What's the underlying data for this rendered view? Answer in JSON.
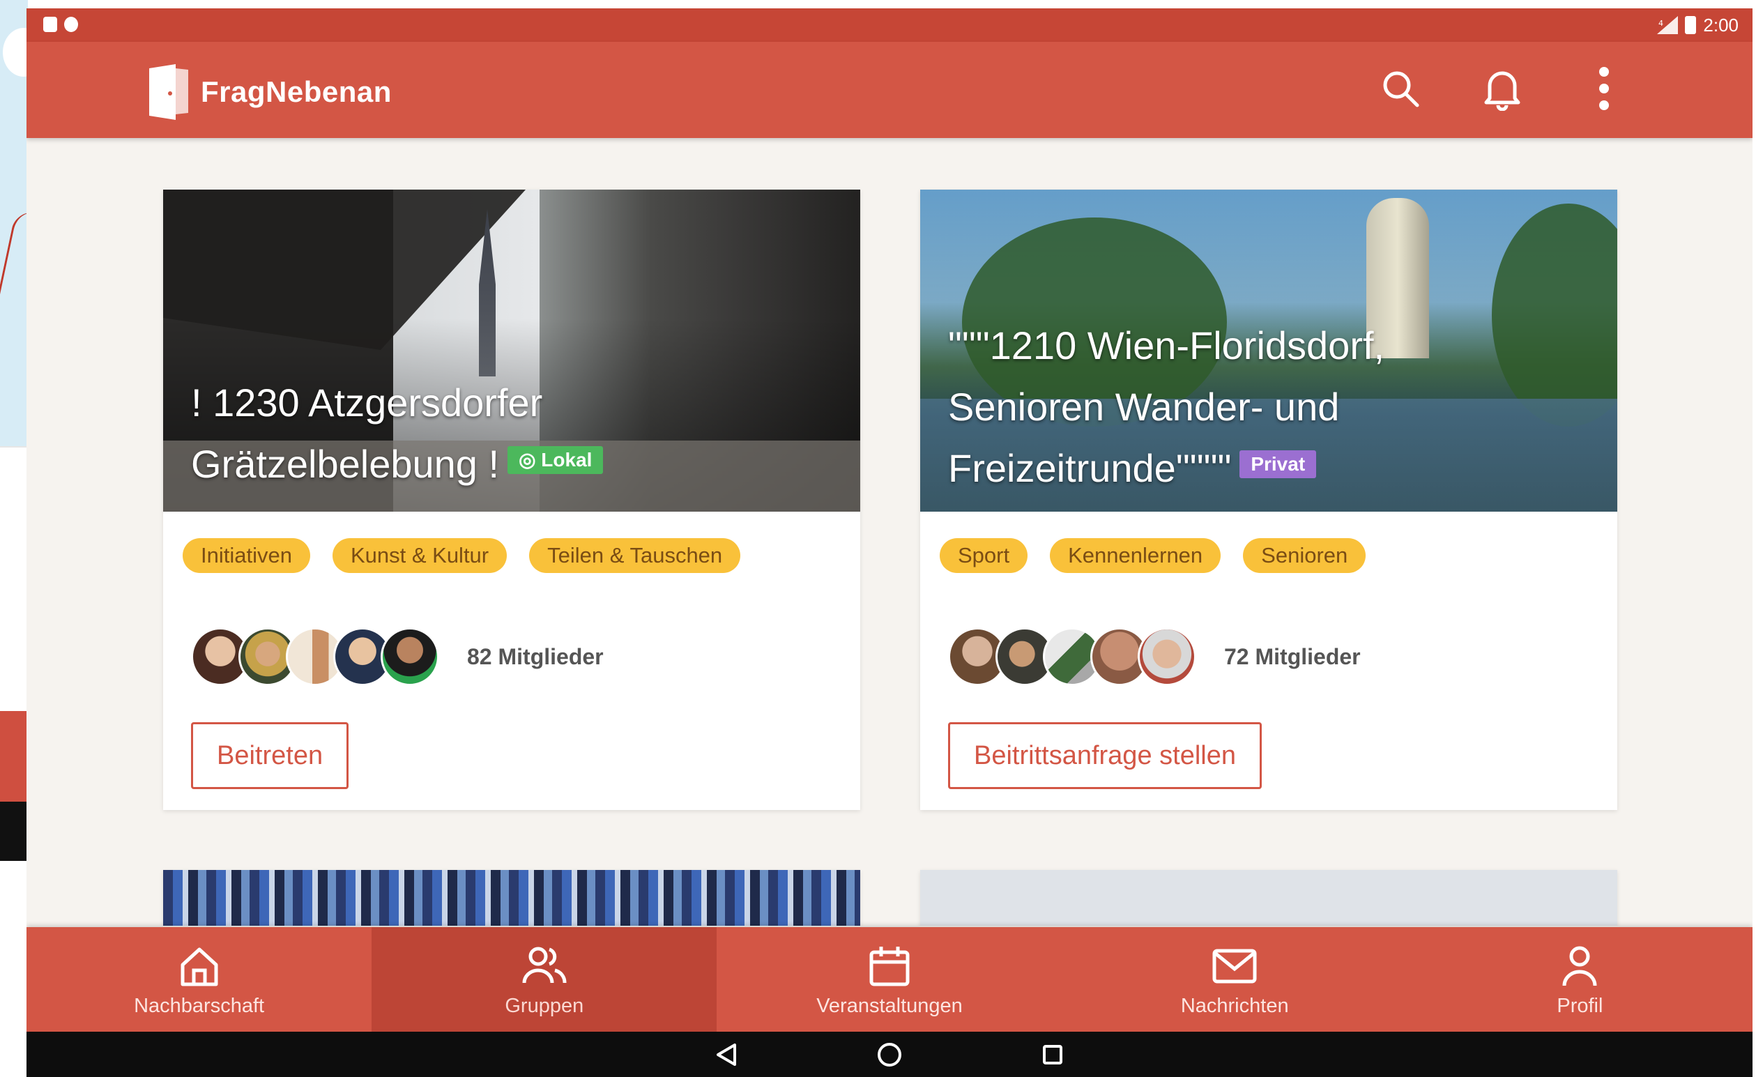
{
  "status_bar": {
    "time": "2:00"
  },
  "app_bar": {
    "title": "FragNebenan",
    "actions": [
      {
        "icon": "search-icon"
      },
      {
        "icon": "bell-icon"
      },
      {
        "icon": "more-vertical-icon"
      }
    ]
  },
  "colors": {
    "brand": "#d35645",
    "tag_bg": "#f9c13a",
    "badge_lokal": "#4cb85c",
    "badge_privat": "#9b6fd1"
  },
  "groups": [
    {
      "title_lines": [
        "! 1230 Atzgersdorfer",
        "Grätzelbelebung !"
      ],
      "badge": "Lokal",
      "badge_icon": "location-pin-icon",
      "tags": [
        "Initiativen",
        "Kunst & Kultur",
        "Teilen & Tauschen"
      ],
      "members": "82 Mitglieder",
      "action": "Beitreten"
    },
    {
      "title_lines": [
        "\"\"\"1210 Wien-Floridsdorf,",
        "Senioren Wander- und",
        "Freizeitrunde\"\"\"\""
      ],
      "badge": "Privat",
      "tags": [
        "Sport",
        "Kennenlernen",
        "Senioren"
      ],
      "members": "72 Mitglieder",
      "action": "Beitrittsanfrage stellen"
    }
  ],
  "bottom_nav": [
    {
      "label": "Nachbarschaft",
      "icon": "home-icon"
    },
    {
      "label": "Gruppen",
      "icon": "users-icon",
      "active": true
    },
    {
      "label": "Veranstaltungen",
      "icon": "calendar-icon"
    },
    {
      "label": "Nachrichten",
      "icon": "mail-icon"
    },
    {
      "label": "Profil",
      "icon": "user-icon"
    }
  ],
  "system_nav": [
    {
      "icon": "back-icon"
    },
    {
      "icon": "home-circle-icon"
    },
    {
      "icon": "recents-icon"
    }
  ]
}
